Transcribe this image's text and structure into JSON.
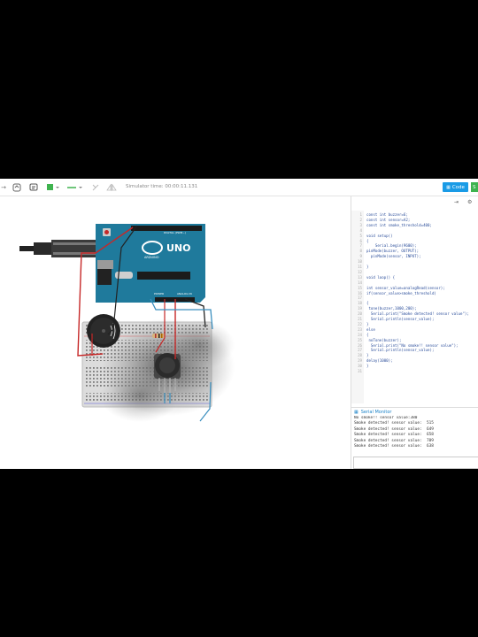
{
  "toolbar": {
    "simulator_time": "Simulator time: 00:00:11.131",
    "code_label": "Code",
    "start_label": "S",
    "icons": [
      "arrow-left-icon",
      "rotate-icon",
      "notes-icon",
      "color-swatch-icon",
      "line-style-icon",
      "flip-icon",
      "mirror-icon"
    ]
  },
  "editor": {
    "line_numbers": [
      "1",
      "2",
      "3",
      "4",
      "5",
      "6",
      "7",
      "8",
      "9",
      "10",
      "11",
      "12",
      "13",
      "14",
      "15",
      "16",
      "17",
      "18",
      "19",
      "20",
      "21",
      "22",
      "23",
      "24",
      "25",
      "26",
      "27",
      "28",
      "29",
      "30",
      "31"
    ],
    "lines": [
      "const int buzzer=6;",
      "const int sensor=A2;",
      "const int smoke_threshold=400;",
      "",
      "void setup()",
      "{",
      "    Serial.begin(9600);",
      "pinMode(buzzer, OUTPUT);",
      "  pinMode(sensor, INPUT);",
      "",
      "}",
      "",
      "void loop() {",
      "",
      "int sensor_value=analogRead(sensor);",
      "if(sensor_value>smoke_threshold)",
      "",
      "{",
      " tone(buzzer,1000,200);",
      "  Serial.print(\"Smoke detected! sensor value\");",
      "  Serial.println(sensor_value);",
      "}",
      "else",
      "{",
      " noTone(buzzer);",
      "  Serial.print(\"No smoke!! sensor value\");",
      "  Serial.println(sensor_value);",
      "}",
      "delay(1000);",
      "}",
      ""
    ]
  },
  "serial_monitor": {
    "title": "Serial Monitor",
    "lines": [
      "No smoke!! sensor value:380",
      "Smoke detected! sensor value:  515",
      "Smoke detected! sensor value:  649",
      "Smoke detected! sensor value:  658",
      "Smoke detected! sensor value:  709",
      "Smoke detected! sensor value:  638"
    ]
  },
  "arduino": {
    "board_name": "UNO",
    "brand": "ARDUINO",
    "header_label": "DIGITAL (PWM~)",
    "power_label": "POWER",
    "analog_label": "ANALOG IN"
  },
  "colors": {
    "board": "#1f7a9c",
    "breadboard": "#dcdcdc",
    "code_button": "#1a9be6",
    "start_button": "#3fb34f",
    "wire_red": "#c62828",
    "wire_black": "#222222",
    "wire_blue": "#3b8fbf"
  }
}
